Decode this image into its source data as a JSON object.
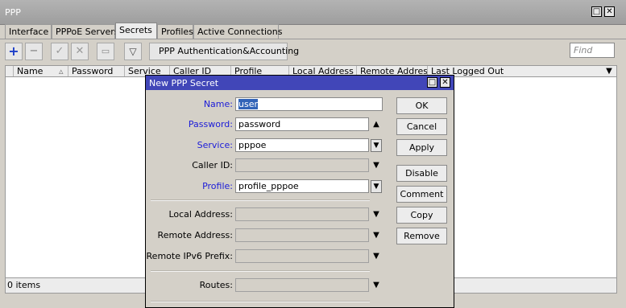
{
  "window": {
    "title": "PPP",
    "tabs": [
      "Interface",
      "PPPoE Servers",
      "Secrets",
      "Profiles",
      "Active Connections"
    ],
    "active_tab": "Secrets",
    "toolbar": {
      "auth_button": "PPP Authentication&Accounting",
      "find_placeholder": "Find"
    },
    "table": {
      "columns": [
        "Name",
        "Password",
        "Service",
        "Caller ID",
        "Profile",
        "Local Address",
        "Remote Address",
        "Last Logged Out"
      ],
      "rows": []
    },
    "status": "0 items"
  },
  "dialog": {
    "title": "New PPP Secret",
    "fields": {
      "name": {
        "label": "Name:",
        "value": "user"
      },
      "password": {
        "label": "Password:",
        "value": "password"
      },
      "service": {
        "label": "Service:",
        "value": "pppoe"
      },
      "caller_id": {
        "label": "Caller ID:",
        "value": ""
      },
      "profile": {
        "label": "Profile:",
        "value": "profile_pppoe"
      },
      "local_address": {
        "label": "Local Address:",
        "value": ""
      },
      "remote_address": {
        "label": "Remote Address:",
        "value": ""
      },
      "remote_ipv6_prefix": {
        "label": "Remote IPv6 Prefix:",
        "value": ""
      },
      "routes": {
        "label": "Routes:",
        "value": ""
      }
    },
    "buttons": {
      "ok": "OK",
      "cancel": "Cancel",
      "apply": "Apply",
      "disable": "Disable",
      "comment": "Comment",
      "copy": "Copy",
      "remove": "Remove"
    }
  },
  "colors": {
    "dialog_titlebar": "#4146b8",
    "label_required": "#1b1bd8",
    "selection": "#3264b8"
  }
}
